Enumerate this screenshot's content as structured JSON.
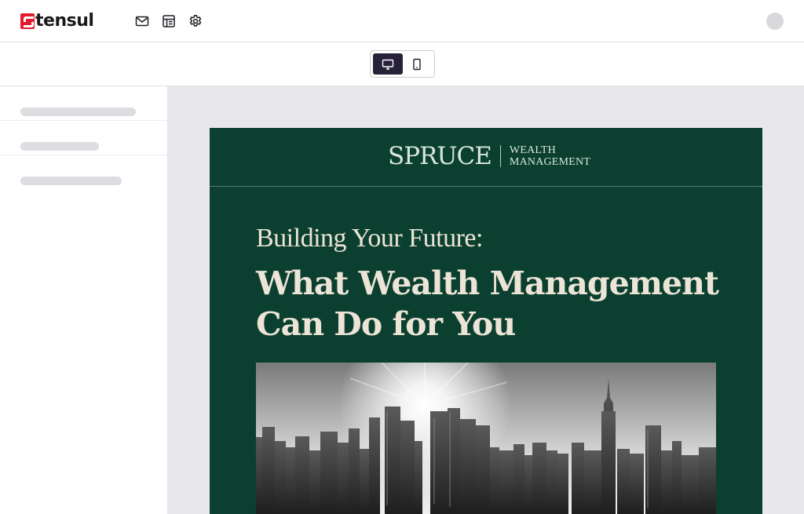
{
  "app": {
    "logo_text": "tensul",
    "logo_mark": "S",
    "brand_color": "#e31b2d",
    "nav_icons": [
      "mail-icon",
      "layout-grid-icon",
      "gear-icon"
    ],
    "avatar": "user-avatar"
  },
  "device_toggle": {
    "options": [
      "desktop-icon",
      "mobile-icon"
    ],
    "selected": "desktop",
    "accent": "#27213a"
  },
  "sidebar": {
    "items": [
      "skeleton",
      "skeleton",
      "skeleton"
    ]
  },
  "email": {
    "background": "#0b4030",
    "brand_name": "SPRUCE",
    "brand_sub_line1": "WEALTH",
    "brand_sub_line2": "MANAGEMENT",
    "kicker": "Building Your Future:",
    "headline_line1": "What Wealth Management",
    "headline_line2": "Can Do for You",
    "hero_image": "city-skyline-photo"
  }
}
